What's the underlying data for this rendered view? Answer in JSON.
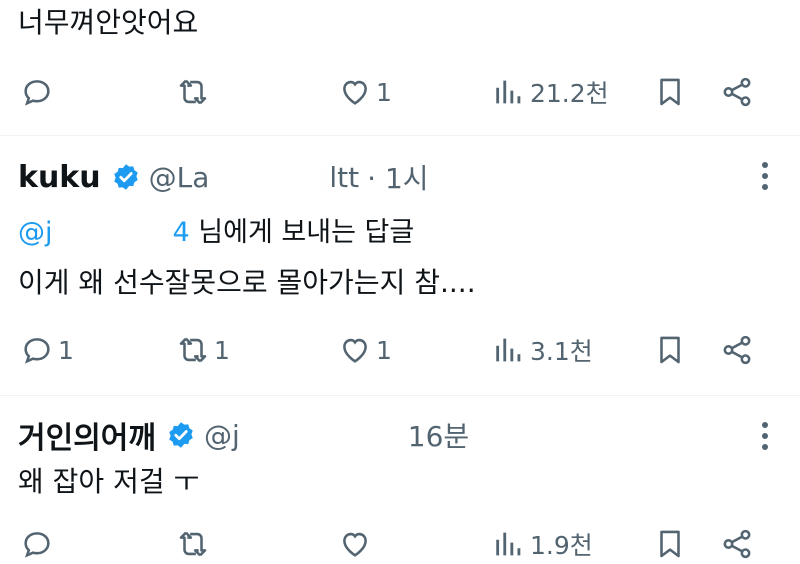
{
  "posts": [
    {
      "text": "너무껴안앗어요",
      "actions": {
        "replies": "",
        "reposts": "",
        "likes": "1",
        "views": "21.2천"
      }
    },
    {
      "author": "kuku",
      "handle": "@La",
      "handle_tail": "ltt",
      "time": "· 1시",
      "reply_to": {
        "mention": "@j",
        "mention_tail": "4",
        "suffix": " 님에게 보내는 답글"
      },
      "text": "이게 왜 선수잘못으로 몰아가는지 참....",
      "actions": {
        "replies": "1",
        "reposts": "1",
        "likes": "1",
        "views": "3.1천"
      }
    },
    {
      "author": "거인의어깨",
      "handle": "@j",
      "handle_tail": "",
      "time": "16분",
      "text": "왜 잡아 저걸 ㅜ",
      "actions": {
        "replies": "",
        "reposts": "",
        "likes": "",
        "views": "1.9천"
      }
    }
  ],
  "colors": {
    "accent": "#1d9bf0",
    "muted": "#536471",
    "text": "#0f1419",
    "divider": "#eff3f4"
  },
  "icons": [
    "reply-icon",
    "repost-icon",
    "like-icon",
    "views-icon",
    "bookmark-icon",
    "share-icon",
    "verified-badge-icon",
    "more-icon"
  ]
}
